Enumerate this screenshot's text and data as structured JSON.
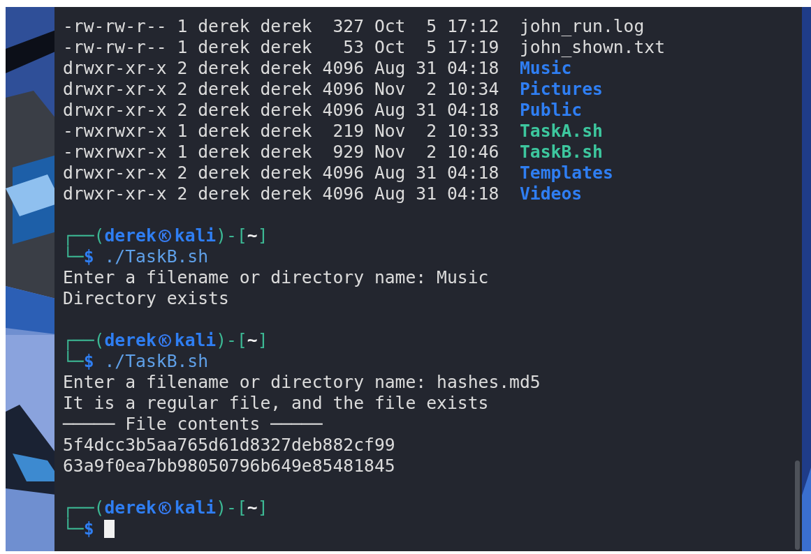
{
  "terminal": {
    "lines": [
      {
        "kind": "listing",
        "info": "-rw-rw-r-- 1 derek derek  327 Oct  5 17:12",
        "name": "john_run.log",
        "color": "#dcdcdc",
        "bold": false
      },
      {
        "kind": "listing",
        "info": "-rw-rw-r-- 1 derek derek   53 Oct  5 17:19",
        "name": "john_shown.txt",
        "color": "#dcdcdc",
        "bold": false
      },
      {
        "kind": "listing",
        "info": "drwxr-xr-x 2 derek derek 4096 Aug 31 04:18",
        "name": "Music",
        "color": "#2f7ef2",
        "bold": true
      },
      {
        "kind": "listing",
        "info": "drwxr-xr-x 2 derek derek 4096 Nov  2 10:34",
        "name": "Pictures",
        "color": "#2f7ef2",
        "bold": true
      },
      {
        "kind": "listing",
        "info": "drwxr-xr-x 2 derek derek 4096 Aug 31 04:18",
        "name": "Public",
        "color": "#2f7ef2",
        "bold": true
      },
      {
        "kind": "listing",
        "info": "-rwxrwxr-x 1 derek derek  219 Nov  2 10:33",
        "name": "TaskA.sh",
        "color": "#3dc79e",
        "bold": true
      },
      {
        "kind": "listing",
        "info": "-rwxrwxr-x 1 derek derek  929 Nov  2 10:46",
        "name": "TaskB.sh",
        "color": "#3dc79e",
        "bold": true
      },
      {
        "kind": "listing",
        "info": "drwxr-xr-x 2 derek derek 4096 Aug 31 04:18",
        "name": "Templates",
        "color": "#2f7ef2",
        "bold": true
      },
      {
        "kind": "listing",
        "info": "drwxr-xr-x 2 derek derek 4096 Aug 31 04:18",
        "name": "Videos",
        "color": "#2f7ef2",
        "bold": true
      },
      {
        "kind": "blank"
      },
      {
        "kind": "prompt",
        "open": "┌──(",
        "user": "derek",
        "host": "kali",
        "mid": ")-[",
        "cwd": "~",
        "close": "]",
        "corner": "└─",
        "sign": "$",
        "command": "./TaskB.sh",
        "cursor": false
      },
      {
        "kind": "output",
        "text": "Enter a filename or directory name: Music"
      },
      {
        "kind": "output",
        "text": "Directory exists"
      },
      {
        "kind": "blank"
      },
      {
        "kind": "prompt",
        "open": "┌──(",
        "user": "derek",
        "host": "kali",
        "mid": ")-[",
        "cwd": "~",
        "close": "]",
        "corner": "└─",
        "sign": "$",
        "command": "./TaskB.sh",
        "cursor": false
      },
      {
        "kind": "output",
        "text": "Enter a filename or directory name: hashes.md5"
      },
      {
        "kind": "output",
        "text": "It is a regular file, and the file exists"
      },
      {
        "kind": "output",
        "text": "───── File contents ─────"
      },
      {
        "kind": "output",
        "text": "5f4dcc3b5aa765d61d8327deb882cf99"
      },
      {
        "kind": "output",
        "text": "63a9f0ea7bb98050796b649e85481845"
      },
      {
        "kind": "blank"
      },
      {
        "kind": "prompt",
        "open": "┌──(",
        "user": "derek",
        "host": "kali",
        "mid": ")-[",
        "cwd": "~",
        "close": "]",
        "corner": "└─",
        "sign": "$",
        "cursor": true
      }
    ]
  }
}
